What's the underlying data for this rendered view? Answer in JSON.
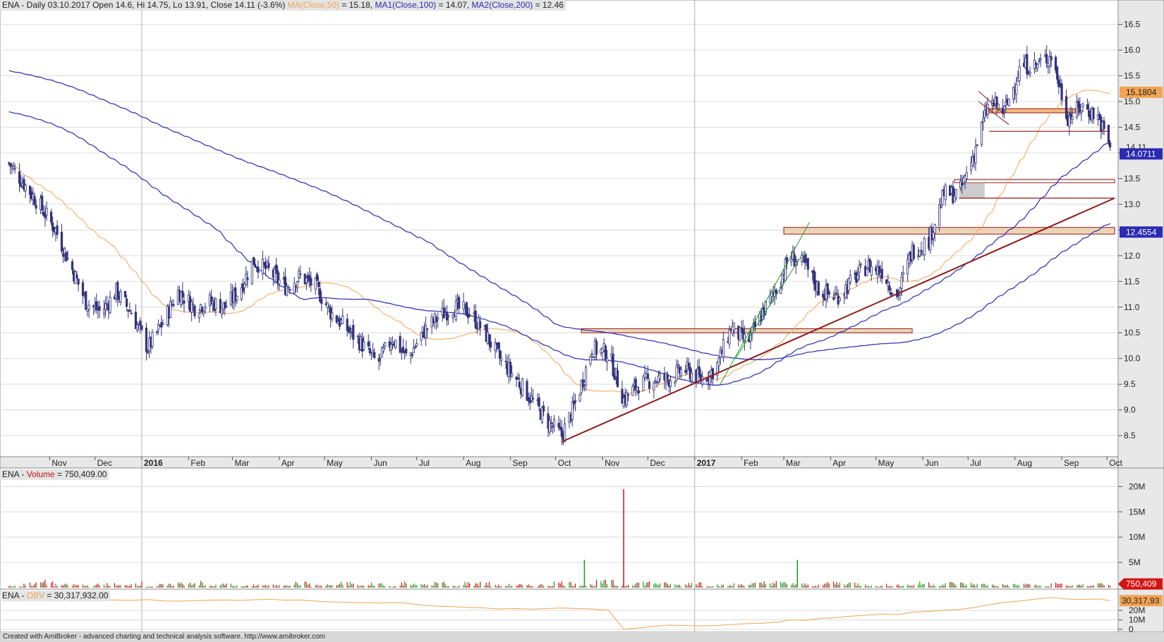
{
  "header": {
    "symbol": "ENA",
    "price": "ENA - Daily 03.10.2017 Open 14.6, Hi 14.75, Lo 13.91, Close 14.11 (-3.6%)",
    "ma": "MA(Close,50)",
    "ma_value": " = 15.18,",
    "ma1": "MA1(Close,100)",
    "ma1_value": " = 14.07,",
    "ma2": "MA2(Close,200)",
    "ma2_value": " = 12.46"
  },
  "volume_header": {
    "symbol": "ENA - ",
    "label": "Volume",
    "value": " = 750,409.00"
  },
  "obv_header": {
    "symbol": "ENA - ",
    "label": "OBV",
    "value": " = 30,317,932.00"
  },
  "footer": "Created with AmiBroker - advanced charting and technical analysis software. http://www.amibroker.com",
  "colors": {
    "background": "#ffffff",
    "candle": "#33337a",
    "ma50": "#f2a453",
    "ma100": "#2a2ab4",
    "ma200": "#2a2ab4",
    "trendline": "#8b1a1a",
    "channel": "#22a022",
    "zone": "#e7c8a0",
    "vol_up": "#1a9a1a",
    "vol_down": "#c81414",
    "obv": "#f2a453",
    "axis_bg": "#e8e8e8"
  },
  "chart_data": [
    {
      "type": "candlestick",
      "title": "ENA - Daily 03.10.2017",
      "ylim": [
        8.2,
        16.7
      ],
      "y_ticks": [
        "8.5",
        "9.0",
        "9.5",
        "10.0",
        "10.5",
        "11.0",
        "11.5",
        "12.0",
        "12.5",
        "13.0",
        "13.5",
        "14.0",
        "14.5",
        "15.0",
        "15.5",
        "16.0",
        "16.5"
      ],
      "x_labels": [
        "Nov",
        "Dec",
        "2016",
        "Feb",
        "Mar",
        "Apr",
        "May",
        "Jun",
        "Jul",
        "Aug",
        "Sep",
        "Oct",
        "Nov",
        "Dec",
        "2017",
        "Feb",
        "Mar",
        "Apr",
        "May",
        "Jun",
        "Jul",
        "Aug",
        "Sep",
        "Oct"
      ],
      "dates": [
        "2015-10-05",
        "2015-10-15",
        "2015-10-25",
        "2015-11-05",
        "2015-11-15",
        "2015-11-25",
        "2015-12-05",
        "2015-12-15",
        "2015-12-25",
        "2016-01-05",
        "2016-01-15",
        "2016-01-25",
        "2016-02-05",
        "2016-02-15",
        "2016-02-25",
        "2016-03-05",
        "2016-03-15",
        "2016-03-25",
        "2016-04-05",
        "2016-04-15",
        "2016-04-25",
        "2016-05-05",
        "2016-05-15",
        "2016-05-25",
        "2016-06-05",
        "2016-06-15",
        "2016-06-25",
        "2016-07-05",
        "2016-07-15",
        "2016-07-25",
        "2016-08-05",
        "2016-08-15",
        "2016-08-25",
        "2016-09-05",
        "2016-09-15",
        "2016-09-25",
        "2016-10-05",
        "2016-10-15",
        "2016-10-25",
        "2016-11-05",
        "2016-11-15",
        "2016-11-25",
        "2016-12-05",
        "2016-12-15",
        "2016-12-25",
        "2017-01-05",
        "2017-01-15",
        "2017-01-25",
        "2017-02-05",
        "2017-02-15",
        "2017-02-25",
        "2017-03-05",
        "2017-03-15",
        "2017-03-25",
        "2017-04-05",
        "2017-04-15",
        "2017-04-25",
        "2017-05-05",
        "2017-05-15",
        "2017-05-25",
        "2017-06-05",
        "2017-06-15",
        "2017-06-25",
        "2017-07-05",
        "2017-07-15",
        "2017-07-25",
        "2017-08-05",
        "2017-08-15",
        "2017-08-25",
        "2017-09-05",
        "2017-09-15",
        "2017-09-25",
        "2017-10-03"
      ],
      "close": [
        13.8,
        13.4,
        13.0,
        12.5,
        11.8,
        11.1,
        10.9,
        11.3,
        10.9,
        10.2,
        10.7,
        11.3,
        11.0,
        11.1,
        11.0,
        11.3,
        11.9,
        11.7,
        11.4,
        11.6,
        11.4,
        10.9,
        10.6,
        10.3,
        9.9,
        10.4,
        10.0,
        10.5,
        10.8,
        11.0,
        10.9,
        10.5,
        10.0,
        9.6,
        9.2,
        8.8,
        8.5,
        9.2,
        10.2,
        10.1,
        9.2,
        9.5,
        9.6,
        9.6,
        9.8,
        9.6,
        9.8,
        10.6,
        10.3,
        10.9,
        11.4,
        12.0,
        11.8,
        11.3,
        11.2,
        11.5,
        11.8,
        11.7,
        11.2,
        12.1,
        12.3,
        13.2,
        13.2,
        14.0,
        15.0,
        14.8,
        15.7,
        15.7,
        15.9,
        14.7,
        14.9,
        14.7,
        14.11
      ],
      "annotations": [
        "15.1804",
        "14.11",
        "14.0711",
        "12.4554"
      ]
    },
    {
      "type": "bar",
      "title": "ENA - Volume",
      "ylim": [
        0,
        22000000
      ],
      "y_ticks": [
        "5M",
        "10M",
        "15M",
        "20M"
      ],
      "last_value_label": "750,409",
      "values": [
        300000,
        700000,
        1000000,
        500000,
        500000,
        400000,
        600000,
        400000,
        800000,
        300000,
        500000,
        800000,
        900000,
        400000,
        600000,
        300000,
        500000,
        400000,
        700000,
        800000,
        400000,
        500000,
        800000,
        400000,
        700000,
        300000,
        900000,
        500000,
        800000,
        300000,
        800000,
        800000,
        400000,
        500000,
        400000,
        500000,
        900000,
        800000,
        500000,
        1000000,
        500000,
        900000,
        900000,
        700000,
        500000,
        900000,
        500000,
        400000,
        600000,
        700000,
        900000,
        800000,
        600000,
        500000,
        900000,
        800000,
        700000,
        300000,
        500000,
        500000,
        800000,
        600000,
        800000,
        700000,
        600000,
        500000,
        500000,
        600000,
        300000,
        700000,
        400000,
        500000,
        750409
      ],
      "spikes": [
        {
          "date": "2016-11-15",
          "value": 19500000
        },
        {
          "date": "2016-10-20",
          "value": 5500000
        },
        {
          "date": "2017-03-10",
          "value": 5500000
        }
      ]
    },
    {
      "type": "line",
      "title": "ENA - OBV",
      "y_ticks": [
        "0",
        "10M",
        "20M"
      ],
      "last_value_label": "30,317,93",
      "values": [
        32000000,
        31000000,
        30500000,
        31000000,
        30000000,
        31500000,
        30800000,
        31000000,
        30500000,
        31500000,
        30000000,
        29800000,
        30200000,
        30800000,
        31000000,
        30500000,
        31200000,
        31800000,
        30800000,
        31000000,
        29800000,
        29000000,
        28500000,
        28200000,
        27800000,
        28500000,
        27500000,
        25500000,
        24500000,
        24000000,
        23000000,
        22500000,
        21500000,
        22000000,
        21200000,
        22000000,
        22500000,
        22000000,
        21500000,
        20000000,
        0,
        1500000,
        3000000,
        4500000,
        4000000,
        3500000,
        4000000,
        5000000,
        6000000,
        6500000,
        7500000,
        10000000,
        9500000,
        11500000,
        12500000,
        14000000,
        15000000,
        16000000,
        15500000,
        18000000,
        19000000,
        20000000,
        21000000,
        23000000,
        26000000,
        28500000,
        30000000,
        32000000,
        33500000,
        32000000,
        31500000,
        32000000,
        30317932
      ]
    }
  ]
}
